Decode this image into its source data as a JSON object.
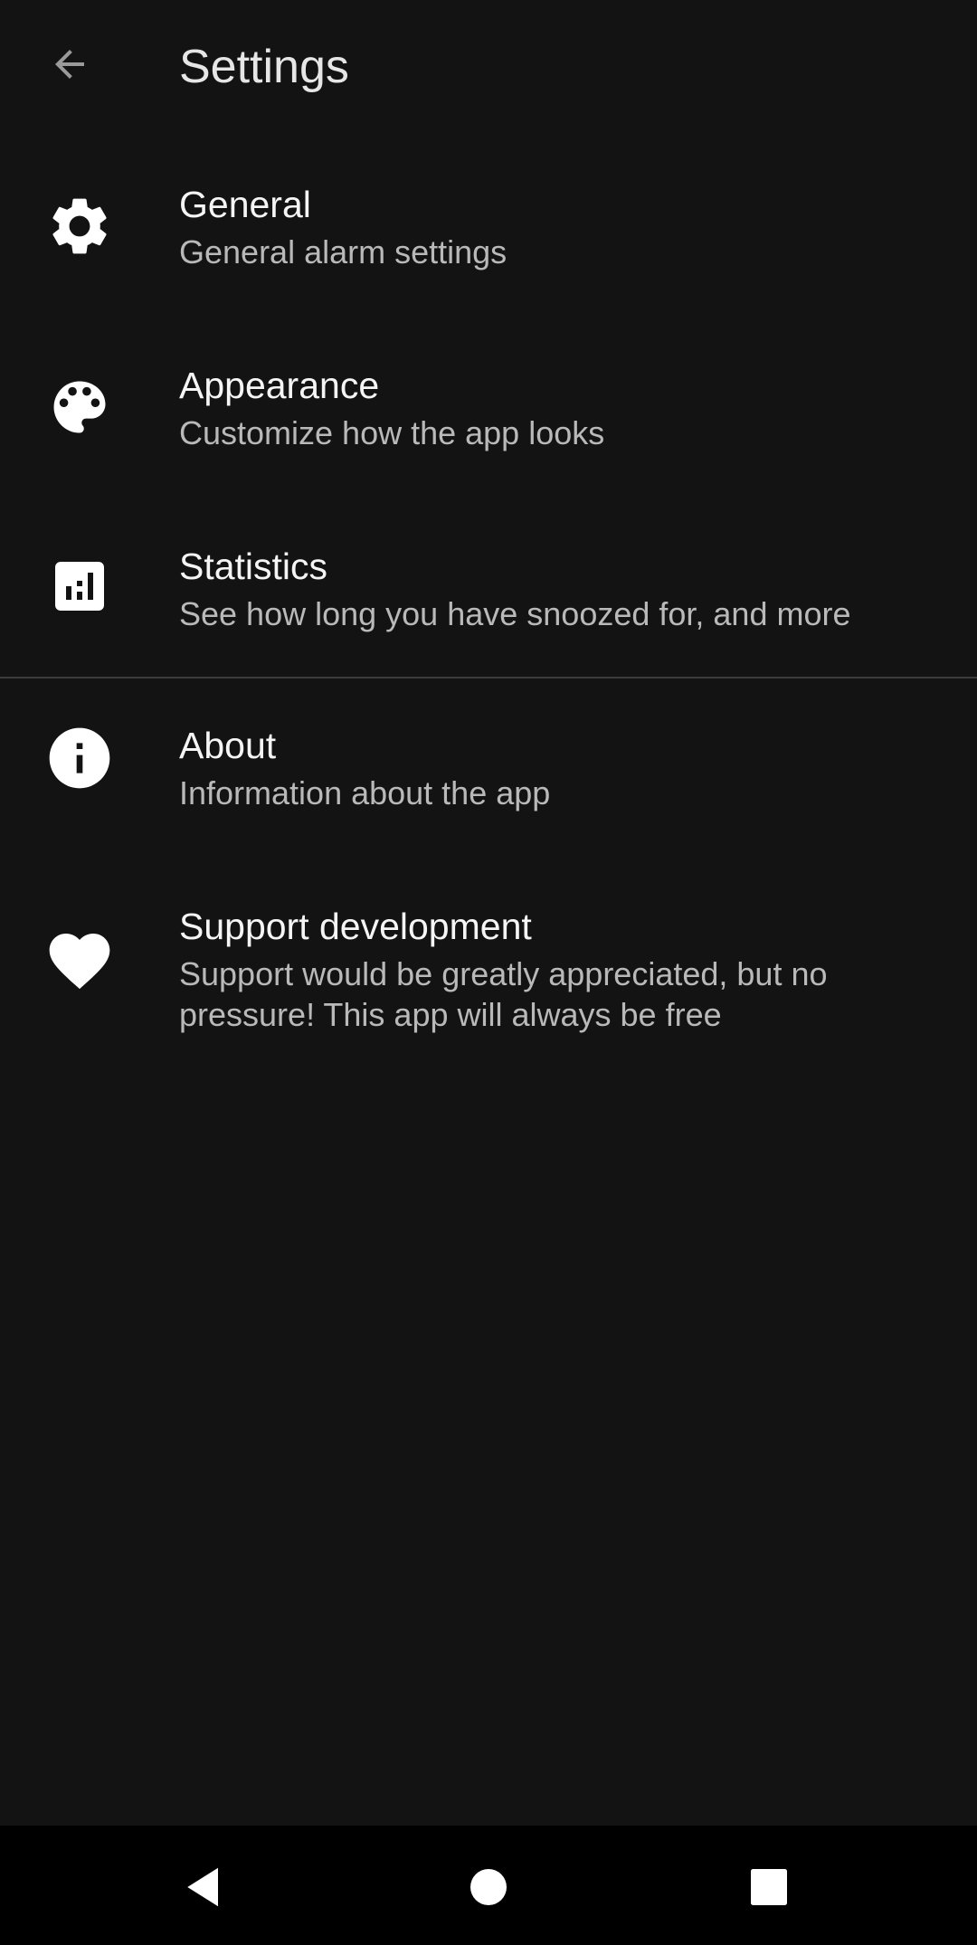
{
  "app_bar": {
    "title": "Settings",
    "back_icon": "arrow-back-icon"
  },
  "items": [
    {
      "icon": "gear-icon",
      "title": "General",
      "summary": "General alarm settings"
    },
    {
      "icon": "palette-icon",
      "title": "Appearance",
      "summary": "Customize how the app looks"
    },
    {
      "icon": "bar-chart-icon",
      "title": "Statistics",
      "summary": "See how long you have snoozed for, and more"
    },
    {
      "icon": "info-icon",
      "title": "About",
      "summary": "Information about the app"
    },
    {
      "icon": "heart-icon",
      "title": "Support development",
      "summary": "Support would be greatly appreciated, but no pressure! This app will always be free"
    }
  ],
  "nav_bar": {
    "back": "nav-back-icon",
    "home": "nav-home-icon",
    "recents": "nav-recents-icon"
  },
  "colors": {
    "background": "#131313",
    "title_text": "#f5f5f5",
    "summary_text": "#b9b9b9",
    "divider": "#3c3c3c",
    "nav_bar": "#000000"
  }
}
